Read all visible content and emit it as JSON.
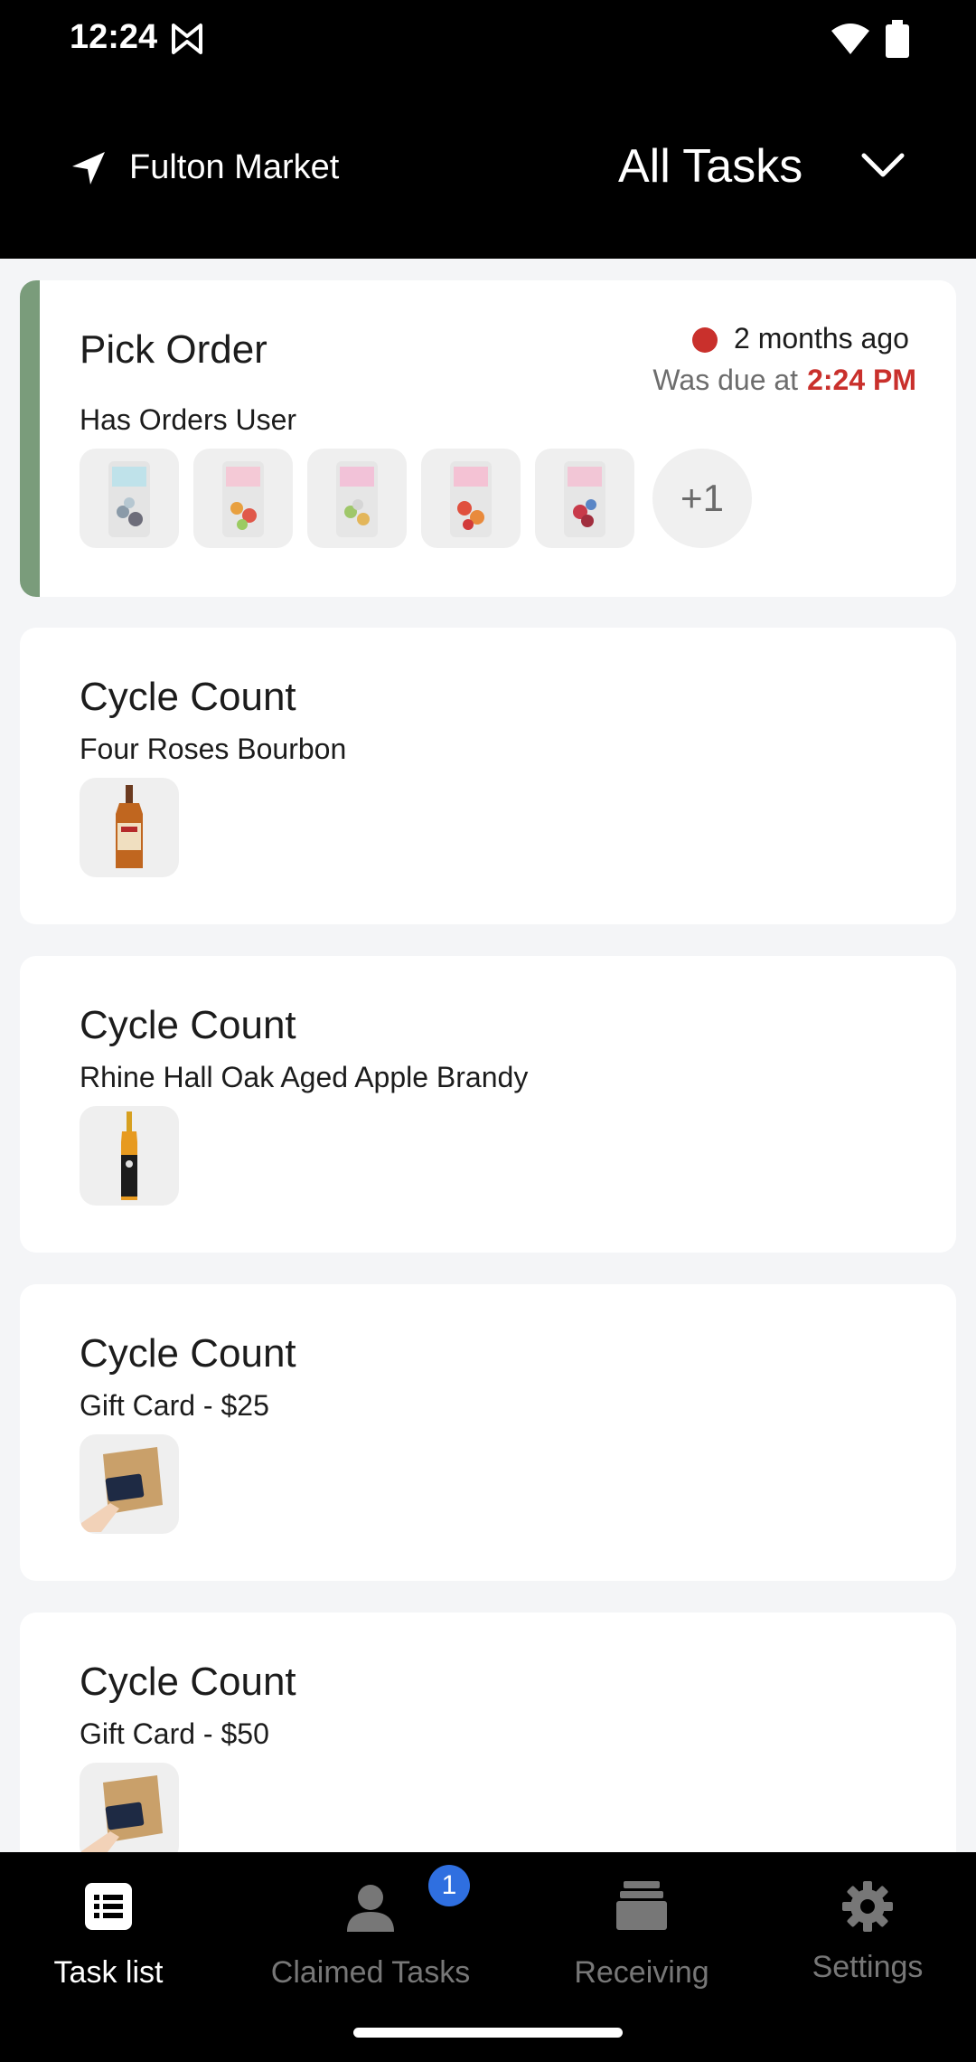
{
  "status_bar": {
    "time": "12:24"
  },
  "header": {
    "location": "Fulton Market",
    "filter": "All Tasks"
  },
  "tasks": [
    {
      "title": "Pick Order",
      "subtitle": "Has Orders User",
      "ago": "2 months ago",
      "due_label": "Was due at",
      "due_time": "2:24 PM",
      "extra_count": "+1",
      "accent_color": "#7a9c7b",
      "overdue_color": "#c9302c"
    },
    {
      "title": "Cycle Count",
      "subtitle": "Four Roses Bourbon"
    },
    {
      "title": "Cycle Count",
      "subtitle": "Rhine Hall Oak Aged Apple Brandy"
    },
    {
      "title": "Cycle Count",
      "subtitle": "Gift Card - $25"
    },
    {
      "title": "Cycle Count",
      "subtitle": "Gift Card - $50"
    }
  ],
  "nav": {
    "items": [
      {
        "label": "Task list",
        "icon": "list-icon",
        "active": true
      },
      {
        "label": "Claimed Tasks",
        "icon": "person-icon",
        "badge": "1"
      },
      {
        "label": "Receiving",
        "icon": "boxes-icon"
      },
      {
        "label": "Settings",
        "icon": "gear-icon"
      }
    ],
    "badge_color": "#2f6fe0"
  }
}
